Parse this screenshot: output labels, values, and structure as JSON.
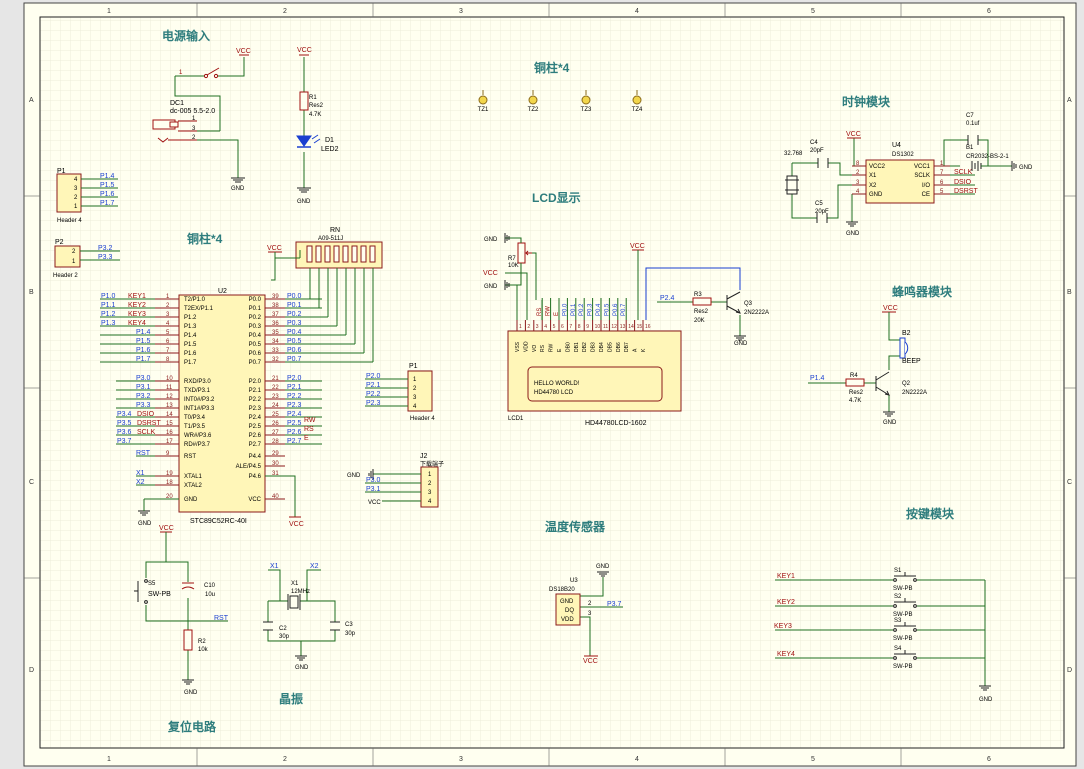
{
  "sheet": {
    "columns": [
      "1",
      "2",
      "3",
      "4",
      "5",
      "6"
    ],
    "rows": [
      "A",
      "B",
      "C",
      "D"
    ]
  },
  "titles": {
    "power": "电源输入",
    "standoff_top": "铜柱*4",
    "standoff_left": "铜柱*4",
    "lcd": "LCD显示",
    "clock": "时钟模块",
    "buzzer": "蜂鸣器模块",
    "temp": "温度传感器",
    "keys": "按键模块",
    "crystal": "晶振",
    "reset": "复位电路"
  },
  "nets": {
    "vcc": "VCC",
    "gnd": "GND",
    "rst": "RST",
    "x1": "X1",
    "x2": "X2",
    "p37": "P3.7",
    "p14": "P1.4",
    "p24": "P2.4",
    "dsio": "DSIO",
    "dsrst": "DSRST",
    "sclk": "SCLK"
  },
  "power": {
    "dc_ref": "DC1",
    "dc_model": "dc-005 5.5-2.0",
    "pins": [
      "1",
      "3",
      "2"
    ],
    "r1_ref": "R1",
    "r1_type": "Res2",
    "r1_val": "4.7K",
    "d1_ref": "D1",
    "d1_type": "LED2"
  },
  "p1": {
    "ref": "P1",
    "model": "Header 4",
    "pins": [
      "4",
      "3",
      "2",
      "1"
    ],
    "nets": [
      "P1.4",
      "P1.5",
      "P1.6",
      "P1.7"
    ]
  },
  "p2": {
    "ref": "P2",
    "model": "Header 2",
    "pins": [
      "2",
      "1"
    ],
    "nets": [
      "P3.2",
      "P3.3"
    ]
  },
  "rn": {
    "ref": "RN",
    "model": "A09-511J"
  },
  "mcu": {
    "ref": "U2",
    "model": "STC89C52RC-40I",
    "left_nets": [
      "P1.0",
      "P1.1",
      "P1.2",
      "P1.3",
      "P1.4",
      "P1.5",
      "P1.6",
      "P1.7"
    ],
    "left_keys": [
      "KEY1",
      "KEY2",
      "KEY3",
      "KEY4"
    ],
    "left_pins": [
      {
        "num": "1",
        "name": "T2/P1.0"
      },
      {
        "num": "2",
        "name": "T2EX/P1.1"
      },
      {
        "num": "3",
        "name": "P1.2"
      },
      {
        "num": "4",
        "name": "P1.3"
      },
      {
        "num": "5",
        "name": "P1.4"
      },
      {
        "num": "6",
        "name": "P1.5"
      },
      {
        "num": "7",
        "name": "P1.6"
      },
      {
        "num": "8",
        "name": "P1.7"
      },
      {
        "num": "10",
        "name": "RXD/P3.0"
      },
      {
        "num": "11",
        "name": "TXD/P3.1"
      },
      {
        "num": "12",
        "name": "INT0#/P3.2"
      },
      {
        "num": "13",
        "name": "INT1#/P3.3"
      },
      {
        "num": "14",
        "name": "T0/P3.4"
      },
      {
        "num": "15",
        "name": "T1/P3.5"
      },
      {
        "num": "16",
        "name": "WR#/P3.6"
      },
      {
        "num": "17",
        "name": "RD#/P3.7"
      },
      {
        "num": "9",
        "name": "RST"
      },
      {
        "num": "19",
        "name": "XTAL1"
      },
      {
        "num": "18",
        "name": "XTAL2"
      },
      {
        "num": "20",
        "name": "GND"
      }
    ],
    "left_nets_p3": [
      "P3.0",
      "P3.1",
      "P3.2",
      "P3.3",
      "P3.4",
      "P3.5",
      "P3.6",
      "P3.7"
    ],
    "left_p3_signals": [
      "DSIO",
      "DSRST",
      "SCLK"
    ],
    "right_pins": [
      {
        "num": "39",
        "name": "P0.0",
        "net": "P0.0"
      },
      {
        "num": "38",
        "name": "P0.1",
        "net": "P0.1"
      },
      {
        "num": "37",
        "name": "P0.2",
        "net": "P0.2"
      },
      {
        "num": "36",
        "name": "P0.3",
        "net": "P0.3"
      },
      {
        "num": "35",
        "name": "P0.4",
        "net": "P0.4"
      },
      {
        "num": "34",
        "name": "P0.5",
        "net": "P0.5"
      },
      {
        "num": "33",
        "name": "P0.6",
        "net": "P0.6"
      },
      {
        "num": "32",
        "name": "P0.7",
        "net": "P0.7"
      },
      {
        "num": "21",
        "name": "P2.0",
        "net": "P2.0"
      },
      {
        "num": "22",
        "name": "P2.1",
        "net": "P2.1"
      },
      {
        "num": "23",
        "name": "P2.2",
        "net": "P2.2"
      },
      {
        "num": "24",
        "name": "P2.3",
        "net": "P2.3"
      },
      {
        "num": "25",
        "name": "P2.4",
        "net": "P2.4"
      },
      {
        "num": "26",
        "name": "P2.5",
        "net": "P2.5"
      },
      {
        "num": "27",
        "name": "P2.6",
        "net": "P2.6"
      },
      {
        "num": "28",
        "name": "P2.7",
        "net": "P2.7"
      },
      {
        "num": "29",
        "name": "P4.4",
        "net": ""
      },
      {
        "num": "30",
        "name": "ALE/P4.5",
        "net": ""
      },
      {
        "num": "31",
        "name": "P4.6",
        "net": ""
      },
      {
        "num": "40",
        "name": "VCC",
        "net": ""
      }
    ],
    "right_signals": [
      "RW",
      "RS",
      "E"
    ]
  },
  "p1b": {
    "ref": "P1",
    "model": "Header 4",
    "pins": [
      "1",
      "2",
      "3",
      "4"
    ],
    "nets": [
      "P2.0",
      "P2.1",
      "P2.2",
      "P2.3"
    ]
  },
  "j2": {
    "ref": "J2",
    "model": "下载端子",
    "pins": [
      "1",
      "2",
      "3",
      "4"
    ],
    "nets": [
      "P3.0",
      "P3.1"
    ]
  },
  "standoffs": [
    "TZ1",
    "TZ2",
    "TZ3",
    "TZ4"
  ],
  "lcd": {
    "ref": "LCD1",
    "model": "HD44780LCD-1602",
    "r7_ref": "R7",
    "r7_val": "10K",
    "pin_nums": [
      "1",
      "2",
      "3",
      "4",
      "5",
      "6",
      "7",
      "8",
      "9",
      "10",
      "11",
      "12",
      "13",
      "14",
      "15",
      "16"
    ],
    "pin_names": [
      "VSS",
      "VDD",
      "VO",
      "RS",
      "RW",
      "E",
      "DB0",
      "DB1",
      "DB2",
      "DB3",
      "DB4",
      "DB5",
      "DB6",
      "DB7",
      "A",
      "K"
    ],
    "bus_nets": [
      "RS",
      "RW",
      "E",
      "P0.0",
      "P0.1",
      "P0.2",
      "P0.3",
      "P0.4",
      "P0.5",
      "P0.6",
      "P0.7"
    ],
    "screen_line1": "HELLO WORLD!",
    "screen_line2": "HD44780 LCD",
    "r3_ref": "R3",
    "r3_type": "Res2",
    "r3_val": "20K",
    "q3_ref": "Q3",
    "q3_model": "2N2222A"
  },
  "clock": {
    "c4_ref": "C4",
    "c4_val": "20pF",
    "c5_ref": "C5",
    "c5_val": "20pF",
    "xtal_val": "32.768",
    "u4_ref": "U4",
    "u4_model": "DS1302",
    "left_pins": [
      {
        "num": "8",
        "name": "VCC2"
      },
      {
        "num": "2",
        "name": "X1"
      },
      {
        "num": "3",
        "name": "X2"
      },
      {
        "num": "4",
        "name": "GND"
      }
    ],
    "right_pins": [
      {
        "num": "1",
        "name": "VCC1"
      },
      {
        "num": "7",
        "name": "SCLK"
      },
      {
        "num": "6",
        "name": "I/O"
      },
      {
        "num": "5",
        "name": "CE"
      }
    ],
    "right_nets": [
      "SCLK",
      "DSIO",
      "DSRST"
    ],
    "c7_ref": "C7",
    "c7_val": "0.1uf",
    "b1_ref": "B1",
    "b1_model": "CR2032-BS-2-1"
  },
  "buzzer": {
    "b2_ref": "B2",
    "b2_model": "BEEP",
    "r4_ref": "R4",
    "r4_type": "Res2",
    "r4_val": "4.7K",
    "q2_ref": "Q2",
    "q2_model": "2N2222A"
  },
  "temp": {
    "ref": "U3",
    "model": "DS18B20",
    "pins": [
      {
        "num": "1",
        "name": "GND"
      },
      {
        "num": "2",
        "name": "DQ"
      },
      {
        "num": "3",
        "name": "VDD"
      }
    ]
  },
  "keys": {
    "nets": [
      "KEY1",
      "KEY2",
      "KEY3",
      "KEY4"
    ],
    "refs": [
      "S1",
      "S2",
      "S3",
      "S4"
    ],
    "model": "SW-PB"
  },
  "crystal": {
    "ref": "X1",
    "val": "12MHz",
    "c2_ref": "C2",
    "c2_val": "30p",
    "c3_ref": "C3",
    "c3_val": "30p"
  },
  "reset": {
    "s5_ref": "S5",
    "s5_model": "SW-PB",
    "c10_ref": "C10",
    "c10_val": "10u",
    "r2_ref": "R2",
    "r2_val": "10k"
  }
}
